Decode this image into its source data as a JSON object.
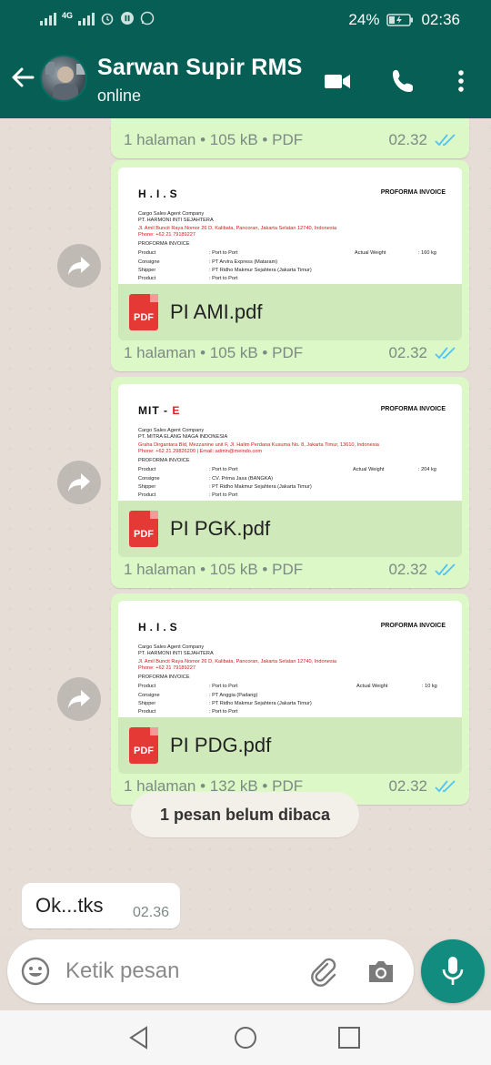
{
  "status_bar": {
    "network": "4G",
    "battery": "24%",
    "clock": "02:36"
  },
  "header": {
    "contact_name": "Sarwan Supir RMS",
    "status": "online"
  },
  "chat": {
    "top_partial": {
      "meta": "1 halaman • 105 kB • PDF",
      "time": "02.32"
    },
    "documents": [
      {
        "company": "H.I.S",
        "company_red": "",
        "doc_title": "PROFORMA INVOICE",
        "preview_lines": [
          "Cargo Sales Agent Company",
          "PT. HARMONI INTI SEJAHTERA",
          "Jl. Amil Buncit Raya Nomor 26 D, Kalibata, Pancoran, Jakarta Selatan 12740, Indonesia",
          "Phone: +62 21 79189227",
          "PROFORMA INVOICE"
        ],
        "rows": [
          {
            "label": "Product",
            "value": ": Port to Port"
          },
          {
            "label": "Consigne",
            "value": ": PT Arvira Express (Mataram)"
          },
          {
            "label": "Shipper",
            "value": ": PT Ridho Makmur Sejahtera (Jakarta Timur)"
          },
          {
            "label": "Product",
            "value": ": Port to Port"
          }
        ],
        "weight_label": "Actual Weight",
        "weight_value": ": 160 kg",
        "file_name": "PI AMI.pdf",
        "meta": "1 halaman • 105 kB • PDF",
        "time": "02.32"
      },
      {
        "company": "MIT - ",
        "company_red": "E",
        "doc_title": "PROFORMA INVOICE",
        "preview_lines": [
          "Cargo Sales Agent Company",
          "PT. MITRA ELANG NIAGA INDONESIA",
          "Graha Dirgantara Bld, Mezzanine unit F, Jl. Halim Perdana Kusuma No. 8, Jakarta Timur, 13610, Indonesia",
          "Phone: +62 21 29826200 | Email: admin@meindo.com",
          "PROFORMA INVOICE"
        ],
        "rows": [
          {
            "label": "Product",
            "value": ": Port to Port"
          },
          {
            "label": "Consigne",
            "value": ": CV. Prima Jasa (BANGKA)"
          },
          {
            "label": "Shipper",
            "value": ": PT Ridho Makmur Sejahtera (Jakarta Timur)"
          },
          {
            "label": "Product",
            "value": ": Port to Port"
          }
        ],
        "weight_label": "Actual Weight",
        "weight_value": ": 204 kg",
        "file_name": "PI PGK.pdf",
        "meta": "1 halaman • 105 kB • PDF",
        "time": "02.32"
      },
      {
        "company": "H.I.S",
        "company_red": "",
        "doc_title": "PROFORMA INVOICE",
        "preview_lines": [
          "Cargo Sales Agent Company",
          "PT. HARMONI INTI SEJAHTERA",
          "Jl. Amil Buncit Raya Nomor 26 D, Kalibata, Pancoran, Jakarta Selatan 12740, Indonesia",
          "Phone: +62 21 79189227",
          "PROFORMA INVOICE"
        ],
        "rows": [
          {
            "label": "Product",
            "value": ": Port to Port"
          },
          {
            "label": "Consigne",
            "value": ": PT Anggia (Padang)"
          },
          {
            "label": "Shipper",
            "value": ": PT Ridho Makmur Sejahtera (Jakarta Timur)"
          },
          {
            "label": "Product",
            "value": ": Port to Port"
          }
        ],
        "weight_label": "Actual Weight",
        "weight_value": ": 10 kg",
        "file_name": "PI PDG.pdf",
        "meta": "1 halaman • 132 kB • PDF",
        "time": "02.32"
      }
    ],
    "unread_banner": "1 pesan belum dibaca",
    "incoming_message": {
      "text": "Ok...tks",
      "time": "02.36"
    }
  },
  "composer": {
    "placeholder": "Ketik pesan"
  },
  "colors": {
    "header": "#075e54",
    "outgoing_bubble": "#dcf8c6",
    "read_ticks": "#4fc3f7",
    "send_button": "#128c7e",
    "pdf_icon": "#e53935"
  }
}
